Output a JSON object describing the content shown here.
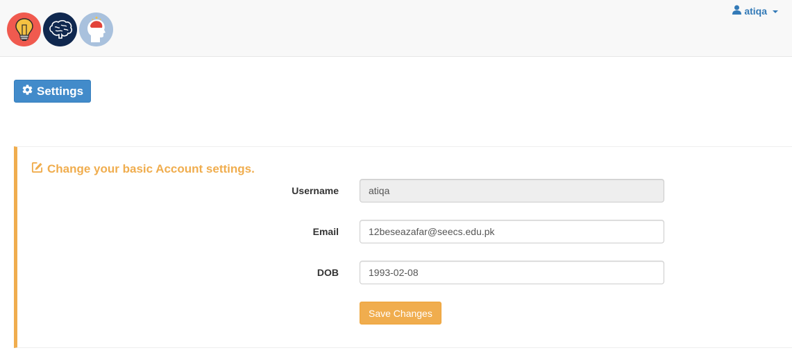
{
  "header": {
    "logos": [
      "lightbulb-logo",
      "brain-logo",
      "head-logo"
    ],
    "user": {
      "name": "atiqa",
      "icon": "user-icon"
    }
  },
  "page": {
    "settings_label": "Settings",
    "settings_icon": "gear-icon"
  },
  "panel": {
    "heading": "Change your basic Account settings.",
    "heading_icon": "edit-icon",
    "accent_color": "#f0ad4e",
    "fields": {
      "username": {
        "label": "Username",
        "value": "atiqa"
      },
      "email": {
        "label": "Email",
        "value": "12beseazafar@seecs.edu.pk"
      },
      "dob": {
        "label": "DOB",
        "value": "1993-02-08"
      }
    },
    "save_label": "Save Changes"
  }
}
